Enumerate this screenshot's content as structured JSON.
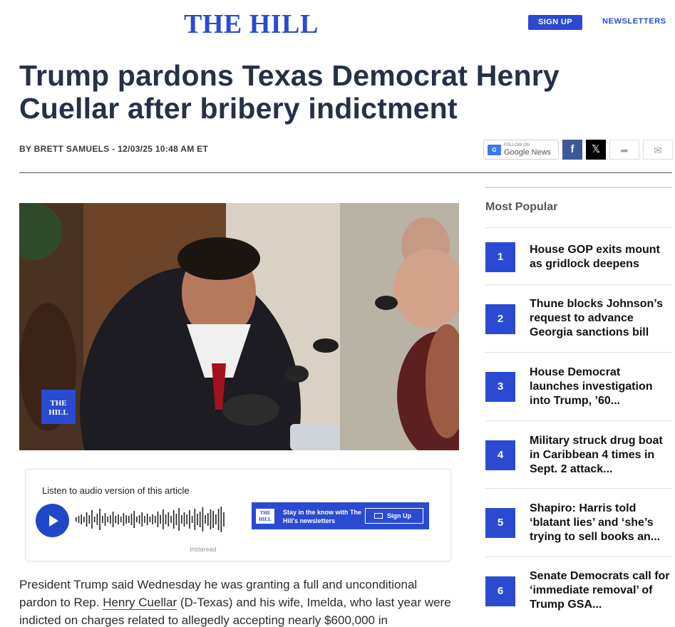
{
  "header": {
    "logo": "THE HILL",
    "signup_label": "SIGN UP",
    "newsletters_label": "NEWSLETTERS"
  },
  "article": {
    "headline": "Trump pardons Texas Democrat Henry Cuellar after bribery indictment",
    "byline": "BY BRETT SAMUELS - 12/03/25 10:48 AM ET",
    "image_watermark": "THE HILL",
    "body_before_link": "President Trump said Wednesday he was granting a full and unconditional pardon to Rep. ",
    "body_link": "Henry Cuellar",
    "body_after_link": " (D-Texas) and his wife, Imelda, who last year were indicted on charges related to allegedly accepting nearly $600,000 in"
  },
  "share": {
    "gnews_follow": "FOLLOW ON",
    "gnews_label": "Google News",
    "facebook_icon": "facebook-icon",
    "x_icon": "x-icon",
    "share_icon": "share-arrow-icon",
    "mail_icon": "mail-icon"
  },
  "audio": {
    "label": "Listen to audio version of this article",
    "powered_by": "Instaread"
  },
  "newsletter_banner": {
    "logo": "THE HILL",
    "text": "Stay in the know with The Hill's newsletters",
    "button": "Sign Up"
  },
  "most_popular": {
    "title": "Most Popular",
    "items": [
      {
        "rank": "1",
        "title": "House GOP exits mount as gridlock deepens"
      },
      {
        "rank": "2",
        "title": "Thune blocks Johnson’s request to advance Georgia sanctions bill"
      },
      {
        "rank": "3",
        "title": "House Democrat launches investigation into Trump, ’60..."
      },
      {
        "rank": "4",
        "title": "Military struck drug boat in Caribbean 4 times in Sept. 2 attack..."
      },
      {
        "rank": "5",
        "title": "Shapiro: Harris told ‘blatant lies’ and ‘she’s trying to sell books an..."
      },
      {
        "rank": "6",
        "title": "Senate Democrats call for ‘immediate removal’ of Trump GSA..."
      }
    ]
  },
  "colors": {
    "brand_blue": "#2a4bd1",
    "headline": "#263147",
    "facebook": "#3b5998"
  }
}
